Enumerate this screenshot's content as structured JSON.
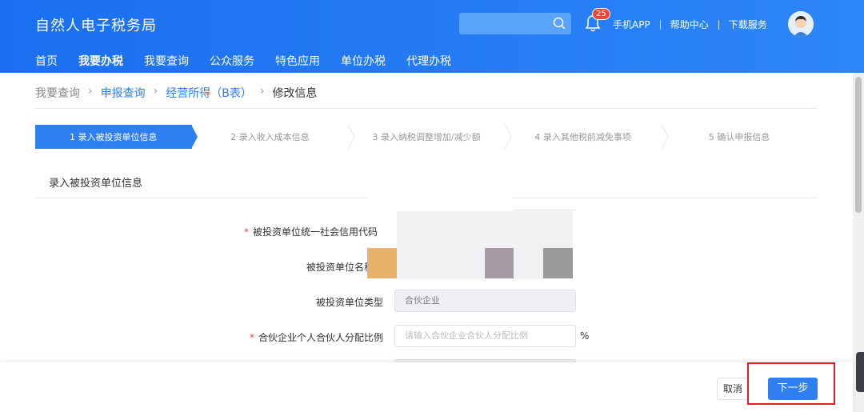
{
  "header": {
    "title": "自然人电子税务局",
    "notification_count": "25",
    "links": [
      "手机APP",
      "帮助中心",
      "下载服务"
    ],
    "icons": {
      "search": "search-icon",
      "bell": "bell-icon",
      "avatar": "user-avatar"
    }
  },
  "nav": {
    "items": [
      "首页",
      "我要办税",
      "我要查询",
      "公众服务",
      "特色应用",
      "单位办税",
      "代理办税"
    ],
    "active": "我要办税"
  },
  "breadcrumb": [
    "我要查询",
    "申报查询",
    "经营所得（B表）",
    "修改信息"
  ],
  "steps": [
    "1  录入被投资单位信息",
    "2  录入收入成本信息",
    "3  录入纳税调整增加/减少额",
    "4  录入其他税前减免事项",
    "5  确认申报信息"
  ],
  "active_step": 0,
  "form": {
    "section_title": "录入被投资单位信息",
    "fields": [
      {
        "label": "被投资单位统一社会信用代码",
        "required": true
      },
      {
        "label": "被投资单位名称",
        "required": false
      },
      {
        "label": "被投资单位类型",
        "required": false,
        "value": "合伙企业"
      },
      {
        "label": "合伙企业个人合伙人分配比例",
        "required": true,
        "placeholder": "请输入合伙企业合伙人分配比例",
        "unit": "%"
      }
    ]
  },
  "footer": {
    "cancel_label": "取消",
    "next_label": "下一步"
  },
  "colors": {
    "primary": "#2f7ff1",
    "header": "#1a6ff0",
    "highlight": "#e02020",
    "required": "#f0443b"
  }
}
